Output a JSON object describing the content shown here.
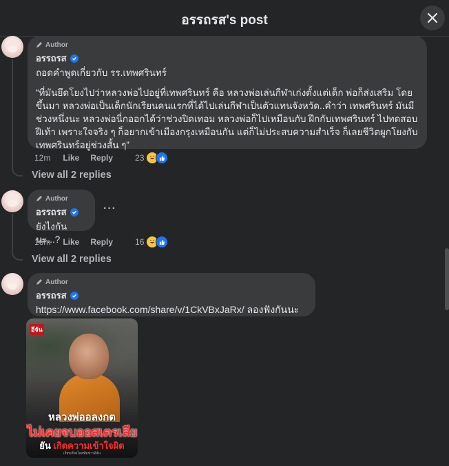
{
  "header": {
    "title": "อรรถรส's post"
  },
  "comments": [
    {
      "badge": "Author",
      "name": "อรรถรส",
      "line1": "ถอดคำพูดเกี่ยวกับ รร.เทพศรินทร์",
      "quote": "“ที่มันยึดโยงไปว่าหลวงพ่อไปอยู่ที่เทพศรินทร์ คือ หลวงพ่อเล่นกีฬาเก่งตั้งแต่เด็ก พ่อก็ส่งเสริม โดยขึ้นมา หลวงพ่อเป็นเด็กนักเรียนคนแรกที่ได้ไปเล่นกีฬาเป็นตัวแทนจังหวัด..คำว่า เทพศรินทร์ มันมีช่วงหนึ่งนะ หลวงพ่อนี่กออกได้ว่าช่วงปิดเทอม หลวงพ่อก็ไปเหมือนกับ ฝึกกับเทพศรินทร์ ไปทดสอบฝีเท้า เพราะใจจริง ๆ ก็อยากเข้าเมืองกรุงเหมือนกัน แต่ก็ไม่ประสบความสำเร็จ ก็เลยชีวิตผูกโยงกับเทพศรินทร์อยู่ช่วงสั้น ๆ”",
      "time": "12m",
      "like": "Like",
      "reply": "Reply",
      "reactions": "23",
      "view_replies": "View all 2 replies"
    },
    {
      "badge": "Author",
      "name": "อรรถรส",
      "text": "ยังไงกันนะ...?",
      "time": "16m",
      "like": "Like",
      "reply": "Reply",
      "reactions": "16",
      "view_replies": "View all 2 replies"
    },
    {
      "badge": "Author",
      "name": "อรรถรส",
      "link": "https://www.facebook.com/share/v/1CkVBxJaRx/",
      "text_after_link": " ลองฟังกันนะ",
      "image": {
        "tag": "อีจัน",
        "caption1": "หลวงพ่ออลงกต",
        "caption2": "ไม่เคยจบออสเตรเลีย",
        "caption3_prefix": "ยัน ",
        "caption3_red": "เกิดความเข้าใจผิด",
        "credit": "เรียบเรียงโดยทีมข่าวอีจัน"
      }
    }
  ],
  "colors": {
    "bg": "#242526",
    "bubble": "#3a3b3c",
    "accent": "#1877f2",
    "muted": "#b0b3b8"
  },
  "icons": [
    "close-icon",
    "pen-icon",
    "verified-badge-icon",
    "haha-reaction-icon",
    "like-reaction-icon",
    "more-options-icon"
  ]
}
